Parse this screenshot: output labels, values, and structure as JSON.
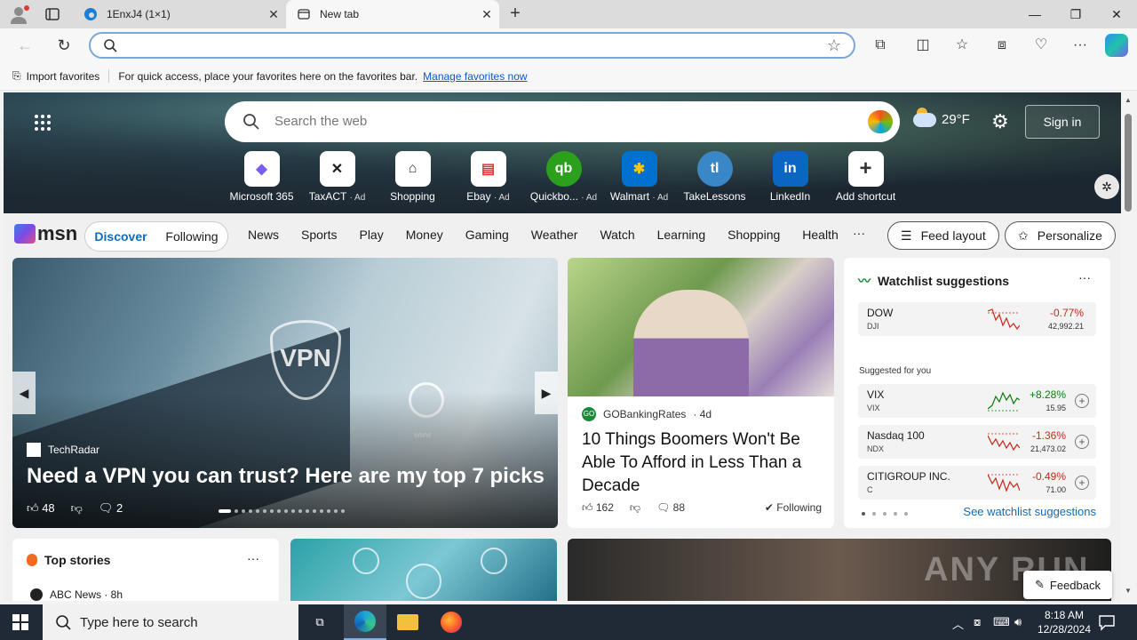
{
  "browser": {
    "tabs": [
      {
        "title": "1EnxJ4 (1×1)"
      },
      {
        "title": "New tab"
      }
    ],
    "address_value": "",
    "favorites_bar": {
      "import_label": "Import favorites",
      "message": "For quick access, place your favorites here on the favorites bar.",
      "manage_link": "Manage favorites now"
    }
  },
  "newtab": {
    "search_placeholder": "Search the web",
    "weather": {
      "temp": "29°F"
    },
    "signin_label": "Sign in",
    "shortcuts": [
      {
        "label": "Microsoft 365",
        "ad": "",
        "icon": "m365-icon",
        "color": "#7b5cf0"
      },
      {
        "label": "TaxACT",
        "ad": "· Ad",
        "icon": "taxact-icon",
        "color": "#1b1b1b"
      },
      {
        "label": "Shopping",
        "ad": "",
        "icon": "shopping-tag-icon",
        "color": "#333333"
      },
      {
        "label": "Ebay",
        "ad": "· Ad",
        "icon": "ebay-icon",
        "color": "#e53238"
      },
      {
        "label": "Quickbo...",
        "ad": "· Ad",
        "icon": "quickbooks-icon",
        "color": "#2ca01c"
      },
      {
        "label": "Walmart",
        "ad": "· Ad",
        "icon": "walmart-icon",
        "color": "#0071ce"
      },
      {
        "label": "TakeLessons",
        "ad": "",
        "icon": "takelessons-icon",
        "color": "#3a87c7"
      },
      {
        "label": "LinkedIn",
        "ad": "",
        "icon": "linkedin-icon",
        "color": "#0a66c2"
      },
      {
        "label": "Add shortcut",
        "ad": "",
        "icon": "plus-icon",
        "color": "#333333"
      }
    ]
  },
  "msn": {
    "logo": "msn",
    "segments": [
      "Discover",
      "Following"
    ],
    "nav": [
      "News",
      "Sports",
      "Play",
      "Money",
      "Gaming",
      "Weather",
      "Watch",
      "Learning",
      "Shopping",
      "Health"
    ],
    "more": "···",
    "feed_layout": "Feed layout",
    "personalize": "Personalize"
  },
  "main_story": {
    "source": "TechRadar",
    "headline": "Need a VPN you can trust? Here are my top 7 picks",
    "likes": "48",
    "comments": "2",
    "image_text": "VPN",
    "www": "www"
  },
  "story2": {
    "source": "GOBankingRates",
    "age": "· 4d",
    "title": "10 Things Boomers Won't Be Able To Afford in Less Than a Decade",
    "likes": "162",
    "comments": "88",
    "following": "Following"
  },
  "watchlist": {
    "title": "Watchlist suggestions",
    "more": "···",
    "primary": {
      "name": "DOW",
      "ticker": "DJI",
      "change": "-0.77%",
      "price": "42,992.21",
      "direction": "down"
    },
    "suggested_label": "Suggested for you",
    "suggestions": [
      {
        "name": "VIX",
        "ticker": "VIX",
        "change": "+8.28%",
        "price": "15.95",
        "direction": "up"
      },
      {
        "name": "Nasdaq 100",
        "ticker": "NDX",
        "change": "-1.36%",
        "price": "21,473.02",
        "direction": "down"
      },
      {
        "name": "CITIGROUP INC.",
        "ticker": "C",
        "change": "-0.49%",
        "price": "71.00",
        "direction": "down"
      }
    ],
    "see_more": "See watchlist suggestions",
    "colors": {
      "up": "#0f7b0f",
      "down": "#c42b1c"
    }
  },
  "top_stories": {
    "title": "Top stories",
    "more": "···",
    "source": "ABC News · 8h"
  },
  "watermark": "ANY RUN",
  "feedback": "Feedback",
  "taskbar": {
    "search_placeholder": "Type here to search",
    "time": "8:18 AM",
    "date": "12/28/2024"
  }
}
